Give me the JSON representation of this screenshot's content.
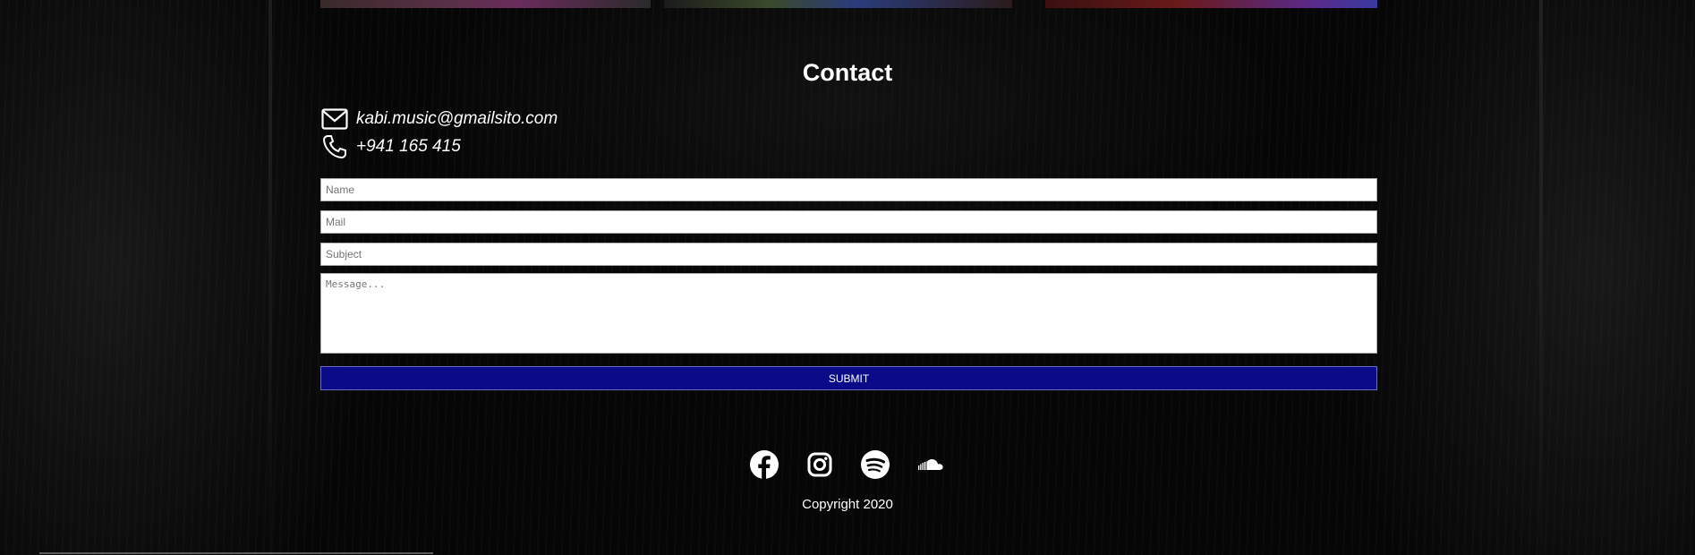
{
  "contact": {
    "title": "Contact",
    "email": "kabi.music@gmailsito.com",
    "phone": "+941 165 415"
  },
  "form": {
    "name_placeholder": "Name",
    "mail_placeholder": "Mail",
    "subject_placeholder": "Subject",
    "message_placeholder": "Message...",
    "submit_label": "SUBMIT"
  },
  "footer": {
    "socials": [
      {
        "name": "facebook",
        "icon": "facebook-icon"
      },
      {
        "name": "instagram",
        "icon": "instagram-icon"
      },
      {
        "name": "spotify",
        "icon": "spotify-icon"
      },
      {
        "name": "soundcloud",
        "icon": "soundcloud-icon"
      }
    ],
    "copyright": "Copyright 2020"
  },
  "colors": {
    "background": "#060606",
    "submit_button": "#0b0b8a",
    "text": "#ffffff"
  }
}
